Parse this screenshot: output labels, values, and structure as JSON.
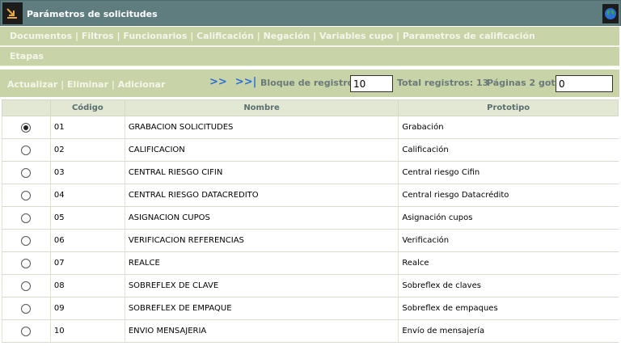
{
  "window": {
    "title": "Parámetros de solicitudes",
    "app_icon": "corner-arrow-icon",
    "globe_icon": "globe-icon"
  },
  "menu": {
    "items": [
      "Documentos",
      "Filtros",
      "Funcionarios",
      "Calificación",
      "Negación",
      "Variables cupo",
      "Parametros de calificación"
    ],
    "items2": [
      "Etapas"
    ],
    "separator": " | "
  },
  "toolbar": {
    "actualizar": "Actualizar",
    "eliminar": "Eliminar",
    "adicionar": "Adicionar",
    "separator": " | ",
    "next": ">>",
    "last": ">>|",
    "block_label": "Bloque de registros:",
    "block_value": "10",
    "total_label": "Total registros: 13",
    "pages_label": "Páginas 2 goto:",
    "goto_value": "0"
  },
  "table": {
    "headers": [
      "",
      "Código",
      "Nombre",
      "Prototipo"
    ],
    "rows": [
      {
        "selected": true,
        "codigo": "01",
        "nombre": "GRABACION SOLICITUDES",
        "prototipo": "Grabación"
      },
      {
        "selected": false,
        "codigo": "02",
        "nombre": "CALIFICACION",
        "prototipo": "Calificación"
      },
      {
        "selected": false,
        "codigo": "03",
        "nombre": "CENTRAL RIESGO CIFIN",
        "prototipo": "Central riesgo Cifin"
      },
      {
        "selected": false,
        "codigo": "04",
        "nombre": "CENTRAL RIESGO DATACREDITO",
        "prototipo": "Central riesgo Datacrédito"
      },
      {
        "selected": false,
        "codigo": "05",
        "nombre": "ASIGNACION CUPOS",
        "prototipo": "Asignación cupos"
      },
      {
        "selected": false,
        "codigo": "06",
        "nombre": "VERIFICACION REFERENCIAS",
        "prototipo": "Verificación"
      },
      {
        "selected": false,
        "codigo": "07",
        "nombre": "REALCE",
        "prototipo": "Realce"
      },
      {
        "selected": false,
        "codigo": "08",
        "nombre": "SOBREFLEX DE CLAVE",
        "prototipo": "Sobreflex de claves"
      },
      {
        "selected": false,
        "codigo": "09",
        "nombre": "SOBREFLEX DE EMPAQUE",
        "prototipo": "Sobreflex de empaques"
      },
      {
        "selected": false,
        "codigo": "10",
        "nombre": "ENVIO MENSAJERIA",
        "prototipo": "Envío de mensajería"
      }
    ]
  }
}
